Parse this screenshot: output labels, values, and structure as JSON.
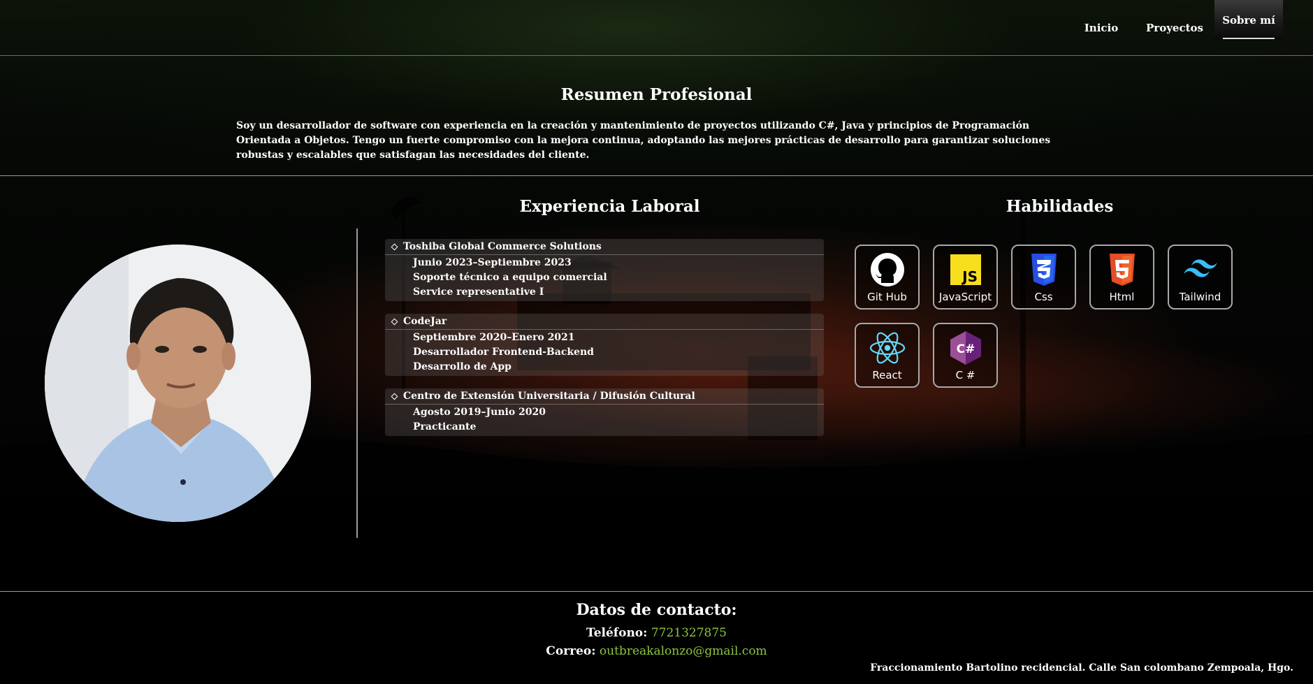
{
  "nav": {
    "items": [
      {
        "label": "Inicio"
      },
      {
        "label": "Proyectos"
      },
      {
        "label": "Sobre mí"
      }
    ]
  },
  "resumen": {
    "title": "Resumen Profesional",
    "text": "Soy un desarrollador de software con experiencia en la creación y mantenimiento de proyectos utilizando C#, Java y principios de Programación Orientada a Objetos. Tengo un fuerte compromiso con la mejora continua, adoptando las mejores prácticas de desarrollo para garantizar soluciones robustas y escalables que satisfagan las necesidades del cliente."
  },
  "experiencia": {
    "title": "Experiencia Laboral",
    "jobs": [
      {
        "company": "Toshiba Global Commerce Solutions",
        "lines": [
          "Junio 2023–Septiembre 2023",
          "Soporte técnico a equipo comercial",
          "Service representative I"
        ]
      },
      {
        "company": "CodeJar",
        "lines": [
          "Septiembre 2020–Enero 2021",
          "Desarrollador Frontend-Backend",
          "Desarrollo de App"
        ]
      },
      {
        "company": "Centro de Extensión Universitaria / Difusión Cultural",
        "lines": [
          "Agosto 2019–Junio 2020",
          "Practicante"
        ]
      }
    ]
  },
  "habilidades": {
    "title": "Habilidades",
    "skills": [
      {
        "label": "Git Hub",
        "icon": "github-icon"
      },
      {
        "label": "JavaScript",
        "icon": "javascript-icon"
      },
      {
        "label": "Css",
        "icon": "css3-icon"
      },
      {
        "label": "Html",
        "icon": "html5-icon"
      },
      {
        "label": "Tailwind",
        "icon": "tailwind-icon"
      },
      {
        "label": "React",
        "icon": "react-icon"
      },
      {
        "label": "C #",
        "icon": "csharp-icon"
      }
    ]
  },
  "contacto": {
    "title": "Datos de contacto:",
    "phone_label": "Teléfono:",
    "phone": "7721327875",
    "email_label": "Correo:",
    "email": "outbreakalonzo@gmail.com",
    "address": "Fraccionamiento Bartolino recidencial. Calle San colombano Zempoala, Hgo."
  },
  "colors": {
    "accent_green": "#8dc63f",
    "nav_border": "#5e7a45"
  }
}
